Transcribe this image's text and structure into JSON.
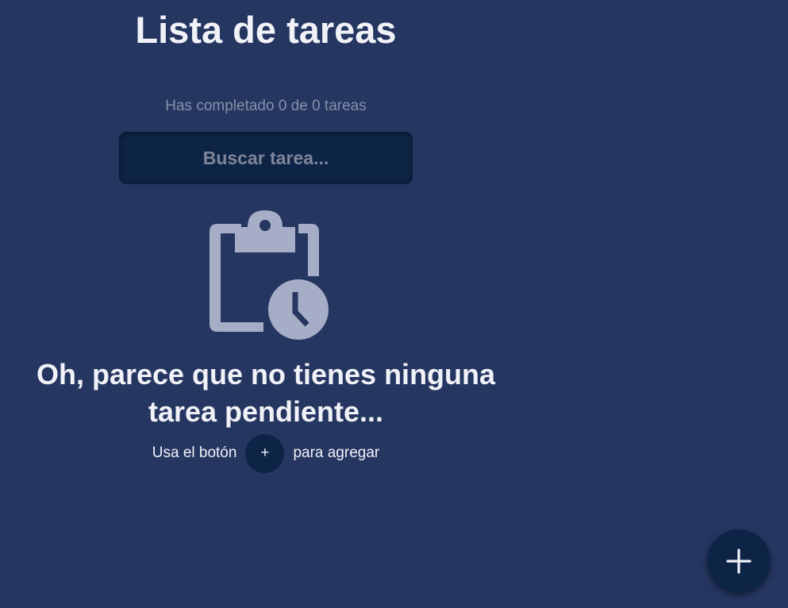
{
  "app": {
    "title": "Lista de tareas",
    "counter_text": "Has completado 0 de 0 tareas"
  },
  "search": {
    "placeholder": "Buscar tarea..."
  },
  "empty_state": {
    "icon": "clipboard-clock-icon",
    "title": "Oh, parece que no tienes ninguna tarea pendiente...",
    "hint_before": "Usa el botón",
    "hint_button_symbol": "+",
    "hint_after": "para agregar"
  },
  "fab": {
    "icon": "plus-icon"
  },
  "colors": {
    "background": "#253661",
    "surface_dark": "#0e2447",
    "text_primary": "#f1f2f8",
    "text_muted": "#8790aa",
    "icon_muted": "#a6adc6"
  }
}
